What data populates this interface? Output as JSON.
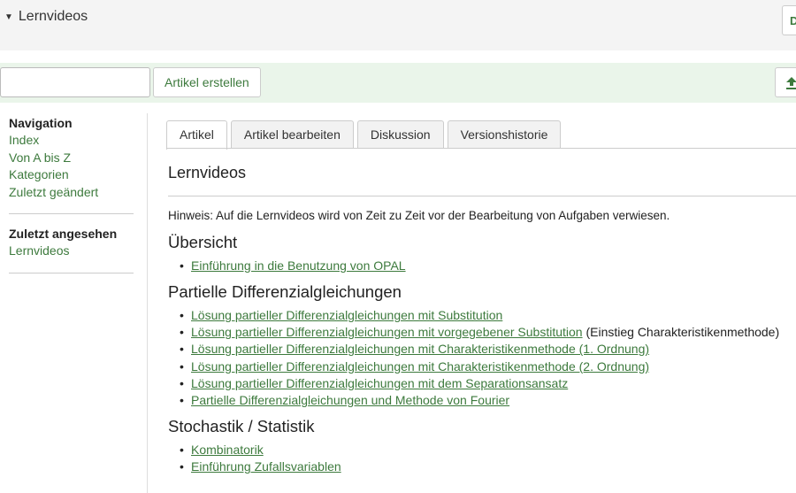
{
  "header": {
    "title": "Lernvideos",
    "corner_button_glyph": "D"
  },
  "toolbar": {
    "search_value": "",
    "create_label": "Artikel erstellen"
  },
  "sidebar": {
    "navigation_heading": "Navigation",
    "navigation_items": [
      "Index",
      "Von A bis Z",
      "Kategorien",
      "Zuletzt geändert"
    ],
    "recent_heading": "Zuletzt angesehen",
    "recent_items": [
      "Lernvideos"
    ]
  },
  "tabs": [
    {
      "label": "Artikel",
      "active": true
    },
    {
      "label": "Artikel bearbeiten",
      "active": false
    },
    {
      "label": "Diskussion",
      "active": false
    },
    {
      "label": "Versionshistorie",
      "active": false
    }
  ],
  "article": {
    "title": "Lernvideos",
    "hint": "Hinweis: Auf die Lernvideos wird von Zeit zu Zeit vor der Bearbeitung von Aufgaben verwiesen.",
    "sections": [
      {
        "heading": "Übersicht",
        "links": [
          {
            "text": "Einführung in die Benutzung von OPAL",
            "suffix": ""
          }
        ]
      },
      {
        "heading": "Partielle Differenzialgleichungen",
        "links": [
          {
            "text": "Lösung partieller Differenzialgleichungen mit Substitution",
            "suffix": ""
          },
          {
            "text": "Lösung partieller Differenzialgleichungen mit vorgegebener Substitution",
            "suffix": " (Einstieg Charakteristikenmethode)"
          },
          {
            "text": "Lösung partieller Differenzialgleichungen mit Charakteristikenmethode (1. Ordnung)",
            "suffix": ""
          },
          {
            "text": "Lösung partieller Differenzialgleichungen mit Charakteristikenmethode (2. Ordnung)",
            "suffix": ""
          },
          {
            "text": "Lösung partieller Differenzialgleichungen mit dem Separationsansatz",
            "suffix": ""
          },
          {
            "text": "Partielle Differenzialgleichungen und Methode von Fourier",
            "suffix": ""
          }
        ]
      },
      {
        "heading": "Stochastik / Statistik",
        "links": [
          {
            "text": "Kombinatorik",
            "suffix": ""
          },
          {
            "text": "Einführung Zufallsvariablen",
            "suffix": ""
          }
        ]
      }
    ]
  },
  "colors": {
    "accent": "#3d7a3d",
    "toolbar_bg": "#eaf5ea",
    "header_bg": "#f4f4f4"
  },
  "icons": {
    "collapse": "triangle-down-icon",
    "upload": "upload-icon"
  }
}
